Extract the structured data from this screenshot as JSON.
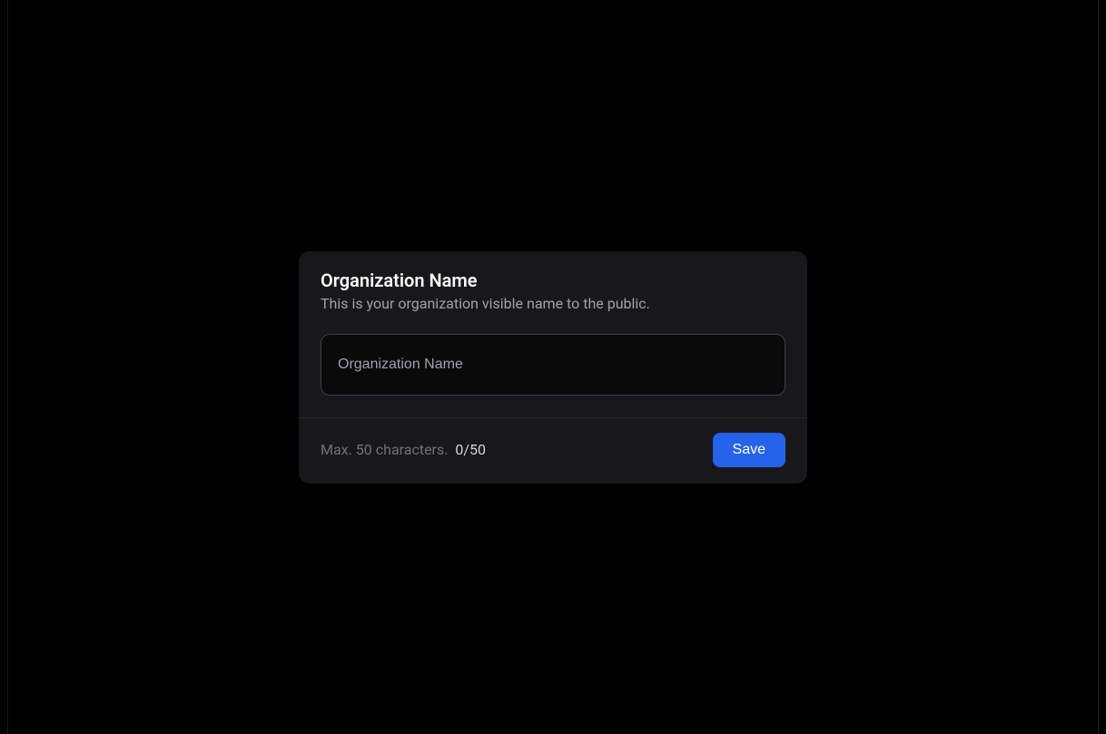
{
  "card": {
    "title": "Organization Name",
    "description": "This is your organization visible name to the public.",
    "input": {
      "value": "",
      "placeholder": "Organization Name"
    },
    "footer": {
      "limit_label": "Max. 50 characters.",
      "count_text": "0/50",
      "save_label": "Save"
    }
  }
}
